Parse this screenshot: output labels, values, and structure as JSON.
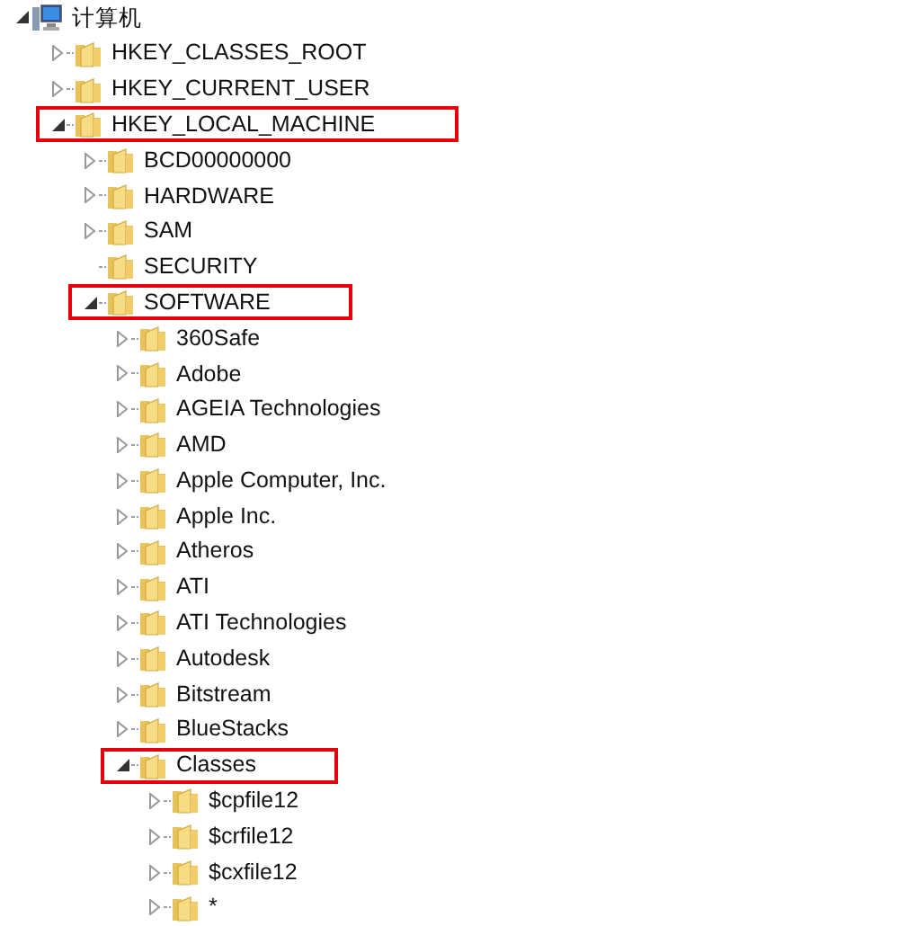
{
  "tree": {
    "label": "计算机",
    "kind": "computer",
    "expanded": true,
    "highlighted": false,
    "children": [
      {
        "label": "HKEY_CLASSES_ROOT",
        "kind": "folder",
        "expanded": false,
        "highlighted": false
      },
      {
        "label": "HKEY_CURRENT_USER",
        "kind": "folder",
        "expanded": false,
        "highlighted": false
      },
      {
        "label": "HKEY_LOCAL_MACHINE",
        "kind": "folder",
        "expanded": true,
        "highlighted": true,
        "children": [
          {
            "label": "BCD00000000",
            "kind": "folder",
            "expanded": false,
            "highlighted": false
          },
          {
            "label": "HARDWARE",
            "kind": "folder",
            "expanded": false,
            "highlighted": false
          },
          {
            "label": "SAM",
            "kind": "folder",
            "expanded": false,
            "highlighted": false
          },
          {
            "label": "SECURITY",
            "kind": "folder",
            "highlighted": false
          },
          {
            "label": "SOFTWARE",
            "kind": "folder",
            "expanded": true,
            "highlighted": true,
            "children": [
              {
                "label": "360Safe",
                "kind": "folder",
                "expanded": false,
                "highlighted": false
              },
              {
                "label": "Adobe",
                "kind": "folder",
                "expanded": false,
                "highlighted": false
              },
              {
                "label": "AGEIA Technologies",
                "kind": "folder",
                "expanded": false,
                "highlighted": false
              },
              {
                "label": "AMD",
                "kind": "folder",
                "expanded": false,
                "highlighted": false
              },
              {
                "label": "Apple Computer, Inc.",
                "kind": "folder",
                "expanded": false,
                "highlighted": false
              },
              {
                "label": "Apple Inc.",
                "kind": "folder",
                "expanded": false,
                "highlighted": false
              },
              {
                "label": "Atheros",
                "kind": "folder",
                "expanded": false,
                "highlighted": false
              },
              {
                "label": "ATI",
                "kind": "folder",
                "expanded": false,
                "highlighted": false
              },
              {
                "label": "ATI Technologies",
                "kind": "folder",
                "expanded": false,
                "highlighted": false
              },
              {
                "label": "Autodesk",
                "kind": "folder",
                "expanded": false,
                "highlighted": false
              },
              {
                "label": "Bitstream",
                "kind": "folder",
                "expanded": false,
                "highlighted": false
              },
              {
                "label": "BlueStacks",
                "kind": "folder",
                "expanded": false,
                "highlighted": false
              },
              {
                "label": "Classes",
                "kind": "folder",
                "expanded": true,
                "highlighted": true,
                "children": [
                  {
                    "label": "$cpfile12",
                    "kind": "folder",
                    "expanded": false,
                    "highlighted": false
                  },
                  {
                    "label": "$crfile12",
                    "kind": "folder",
                    "expanded": false,
                    "highlighted": false
                  },
                  {
                    "label": "$cxfile12",
                    "kind": "folder",
                    "expanded": false,
                    "highlighted": false
                  },
                  {
                    "label": "*",
                    "kind": "folder",
                    "expanded": false,
                    "highlighted": false
                  }
                ]
              }
            ]
          }
        ]
      }
    ]
  }
}
